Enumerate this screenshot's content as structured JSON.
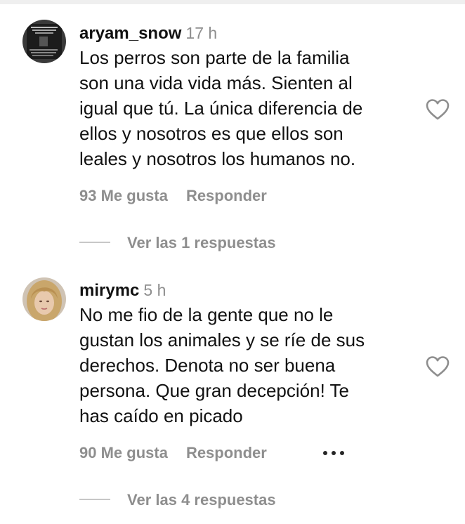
{
  "comments": [
    {
      "username": "aryam_snow",
      "time": "17 h",
      "text_lines": [
        "Los perros son parte de la familia",
        "son una vida vida más. Sienten al",
        "igual que tú. La única diferencia de",
        "ellos y nosotros es que ellos son",
        "leales y nosotros los humanos no."
      ],
      "likes": "93 Me gusta",
      "reply_label": "Responder",
      "view_replies": "Ver las 1 respuestas",
      "avatar_icon": "dark-screenshot-avatar",
      "like_icon": "heart-outline-icon"
    },
    {
      "username": "mirymc",
      "time": "5 h",
      "text_lines": [
        "No me fio de la gente que no le",
        "gustan los animales y se ríe de sus",
        "derechos. Denota no ser buena",
        "persona. Que gran decepción! Te",
        "has caído en picado"
      ],
      "likes": "90 Me gusta",
      "reply_label": "Responder",
      "view_replies": "Ver las 4 respuestas",
      "avatar_icon": "blonde-woman-photo-avatar",
      "like_icon": "heart-outline-icon",
      "more_icon": "more-options-icon"
    }
  ],
  "colors": {
    "text": "#111111",
    "muted": "#8e8e8e",
    "divider": "#c7c7c7"
  }
}
